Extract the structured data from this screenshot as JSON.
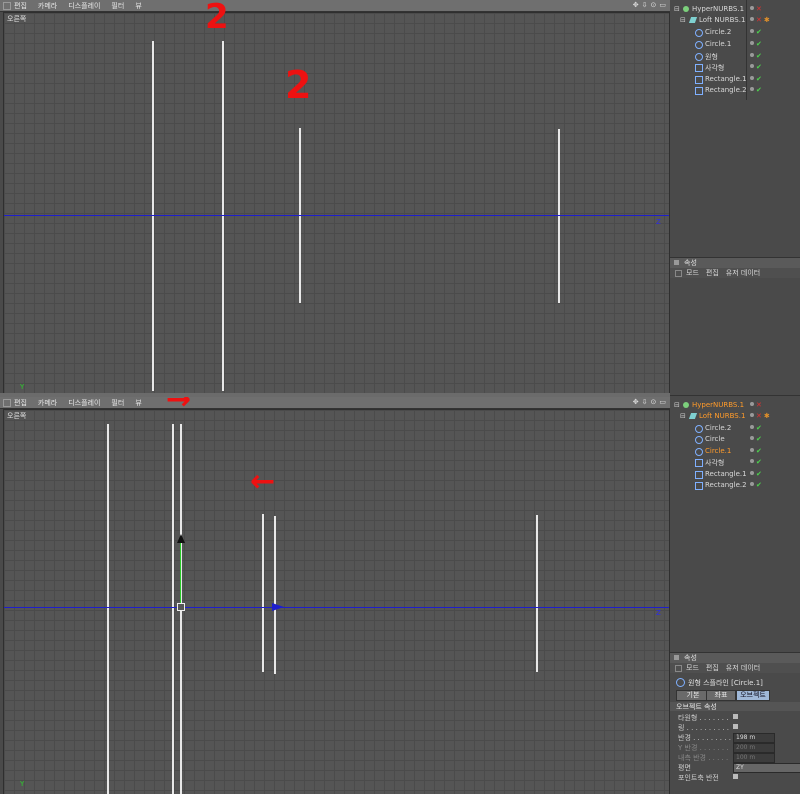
{
  "top_view": {
    "menu": [
      "편집",
      "카메라",
      "디스플레이",
      "필터",
      "뷰"
    ],
    "tools": [
      "✥",
      "⇩",
      "⊙",
      "▭"
    ],
    "label": "오른쪽",
    "z_label": "Z",
    "y_label": "Y"
  },
  "bottom_view": {
    "menu": [
      "편집",
      "카메라",
      "디스플레이",
      "필터",
      "뷰"
    ],
    "tools": [
      "✥",
      "⇩",
      "⊙",
      "▭"
    ],
    "label": "오른쪽",
    "z_label": "Z",
    "y_label": "Y"
  },
  "annotations": {
    "a1": "2",
    "a2": "2",
    "a3": "→",
    "a4": "←"
  },
  "object_tree_top": [
    {
      "name": "HyperNURBS.1",
      "icon": "hypernurbs-icon",
      "highlight": false,
      "tag": "x"
    },
    {
      "name": "Loft NURBS.1",
      "icon": "loft-icon",
      "highlight": false,
      "tag": "x"
    },
    {
      "name": "Circle.2",
      "icon": "circle-icon",
      "highlight": false,
      "tag": "check"
    },
    {
      "name": "Circle.1",
      "icon": "circle-icon",
      "highlight": false,
      "tag": "check"
    },
    {
      "name": "원형",
      "icon": "circle-icon",
      "highlight": false,
      "tag": "check"
    },
    {
      "name": "사각형",
      "icon": "rectangle-icon",
      "highlight": false,
      "tag": "check"
    },
    {
      "name": "Rectangle.1",
      "icon": "rectangle-icon",
      "highlight": false,
      "tag": "check"
    },
    {
      "name": "Rectangle.2",
      "icon": "rectangle-icon",
      "highlight": false,
      "tag": "check"
    }
  ],
  "object_tree_bottom": [
    {
      "name": "HyperNURBS.1",
      "icon": "hypernurbs-icon",
      "highlight": true,
      "tag": "x"
    },
    {
      "name": "Loft NURBS.1",
      "icon": "loft-icon",
      "highlight": true,
      "tag": "x"
    },
    {
      "name": "Circle.2",
      "icon": "circle-icon",
      "highlight": false,
      "tag": "check"
    },
    {
      "name": "Circle",
      "icon": "circle-icon",
      "highlight": false,
      "tag": "check"
    },
    {
      "name": "Circle.1",
      "icon": "circle-icon",
      "highlight": true,
      "tag": "check"
    },
    {
      "name": "사각형",
      "icon": "rectangle-icon",
      "highlight": false,
      "tag": "check"
    },
    {
      "name": "Rectangle.1",
      "icon": "rectangle-icon",
      "highlight": false,
      "tag": "check"
    },
    {
      "name": "Rectangle.2",
      "icon": "rectangle-icon",
      "highlight": false,
      "tag": "check"
    }
  ],
  "attributes_top": {
    "title": "속성",
    "menu": [
      "모드",
      "편집",
      "유저 데이터"
    ]
  },
  "attributes_bottom": {
    "title": "속성",
    "menu": [
      "모드",
      "편집",
      "유저 데이터"
    ],
    "object_title": "원형 스플라인 [Circle.1]",
    "tabs": [
      "기본",
      "좌표",
      "오브젝트"
    ],
    "active_tab": "오브젝트",
    "section": "오브젝트 속성",
    "rows": [
      {
        "label": "타원형 . . . . . . .",
        "type": "check",
        "value": ""
      },
      {
        "label": "링 . . . . . . . . . .",
        "type": "check",
        "value": ""
      },
      {
        "label": "반경 . . . . . . . . .",
        "type": "field",
        "value": "198 m",
        "dim": false
      },
      {
        "label": "Y 반경 . . . . . . .",
        "type": "field",
        "value": "200 m",
        "dim": true
      },
      {
        "label": "내측 반경 . . . . .",
        "type": "field",
        "value": "100 m",
        "dim": true
      },
      {
        "label": "평면",
        "type": "field",
        "value": "ZY",
        "dim": false
      },
      {
        "label": "포인트축 반전",
        "type": "check",
        "value": ""
      }
    ]
  }
}
